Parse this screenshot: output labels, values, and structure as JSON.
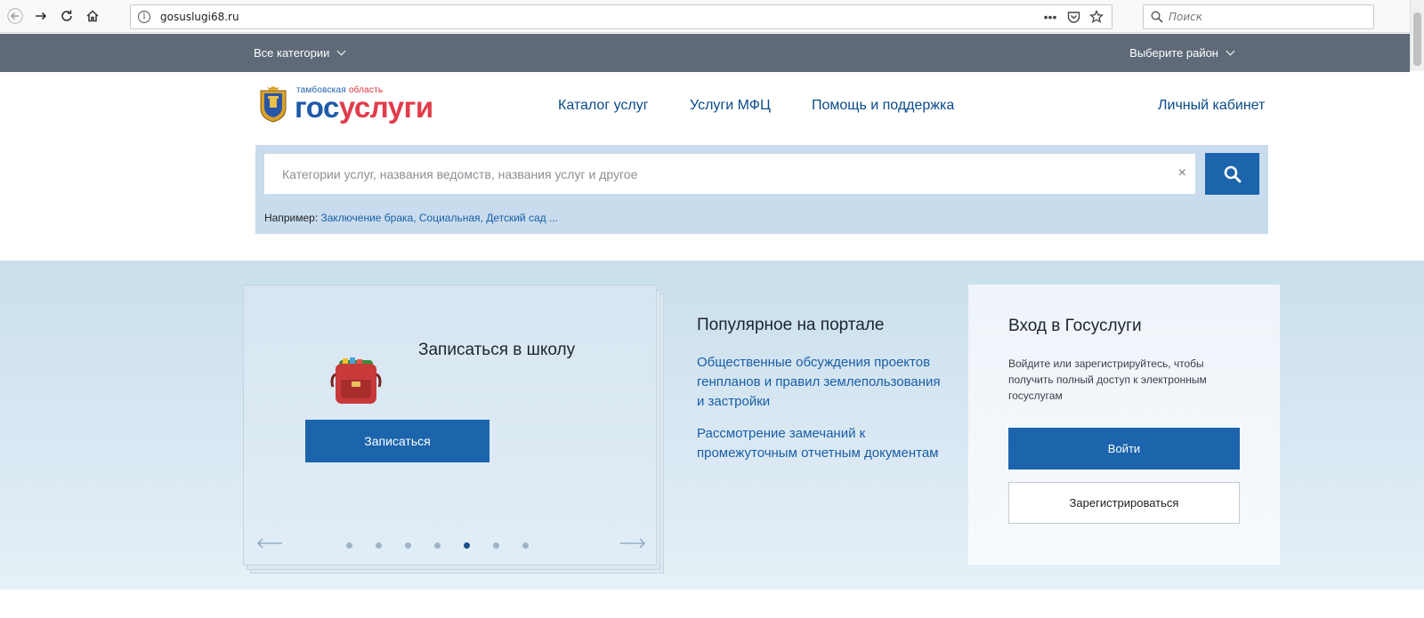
{
  "browser": {
    "url": "gosuslugi68.ru",
    "search_placeholder": "Поиск"
  },
  "topbar": {
    "categories_label": "Все категории",
    "region_label": "Выберите район"
  },
  "header": {
    "logo_region_part1": "тамбовская",
    "logo_region_part2": "область",
    "logo_brand_part1": "гос",
    "logo_brand_part2": "услуги",
    "nav": {
      "catalog": "Каталог услуг",
      "mfc": "Услуги МФЦ",
      "help": "Помощь и поддержка",
      "cabinet": "Личный кабинет"
    }
  },
  "search": {
    "placeholder": "Категории услуг, названия ведомств, названия услуг и другое",
    "clear_glyph": "×",
    "examples_label": "Например:",
    "examples_links": "Заключение брака, Социальная, Детский сад ..."
  },
  "slider": {
    "title": "Записаться в школу",
    "button": "Записаться",
    "dots_total": 7,
    "active_dot": 5
  },
  "popular": {
    "heading": "Популярное на портале",
    "links": [
      "Общественные обсуждения проектов генпланов и правил землепользования и застройки",
      "Рассмотрение замечаний к промежуточным отчетным документам"
    ]
  },
  "login": {
    "heading": "Вход в Госуслуги",
    "description": "Войдите или зарегистрируйтесь, чтобы получить полный доступ к электронным госуслугам",
    "login_button": "Войти",
    "register_button": "Зарегистрироваться"
  },
  "colors": {
    "brand_blue": "#1c64ac",
    "brand_red": "#e23b4a",
    "topstrip": "#5e6a77",
    "search_panel": "#c8dced"
  }
}
